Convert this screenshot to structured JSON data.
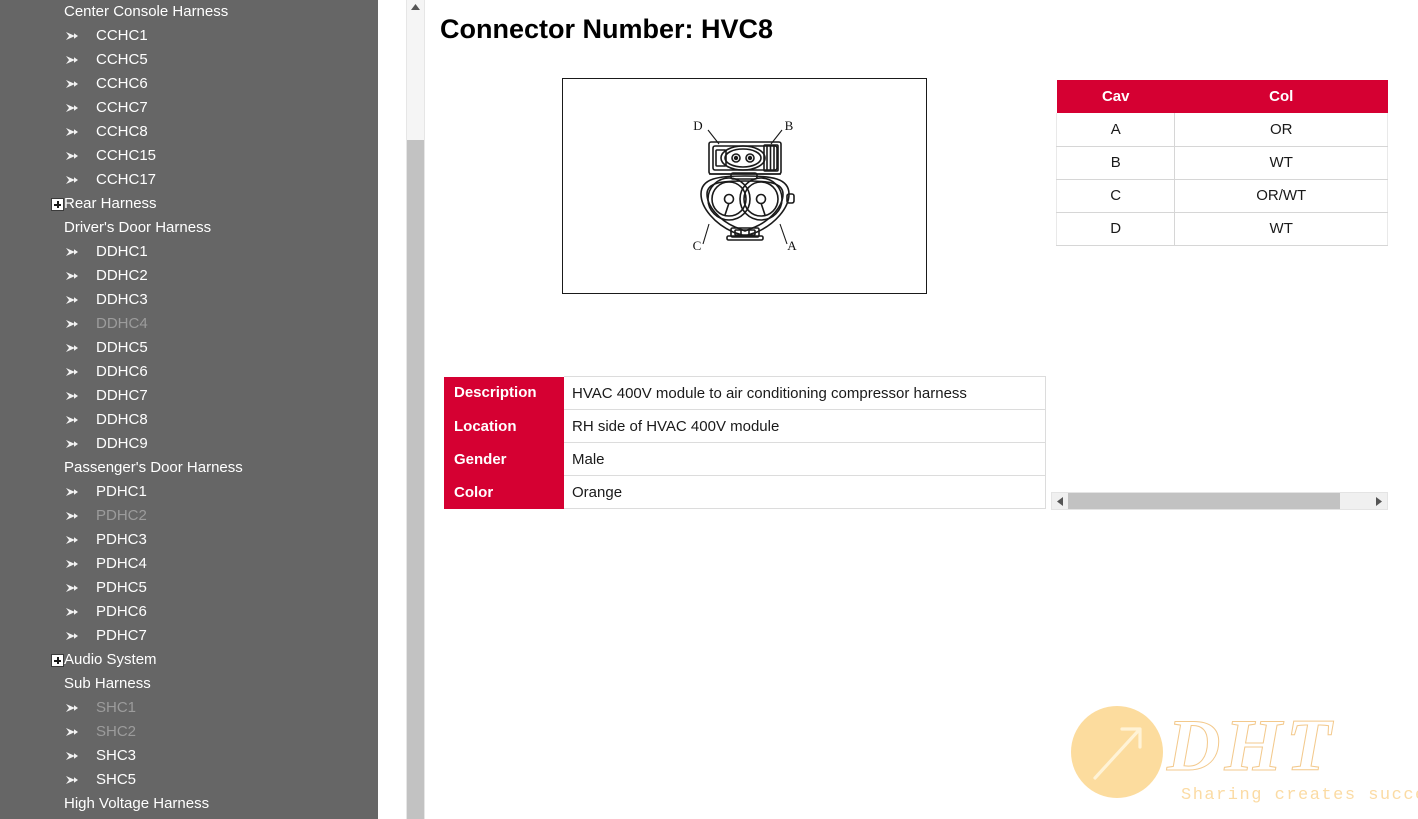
{
  "sidebar": {
    "background_color": "#666666",
    "items": [
      {
        "label": "Center Console Harness",
        "type": "group",
        "icon": "none",
        "dim": false
      },
      {
        "label": "CCHC1",
        "type": "child",
        "icon": "arrow-right-icon",
        "dim": false
      },
      {
        "label": "CCHC5",
        "type": "child",
        "icon": "arrow-right-icon",
        "dim": false
      },
      {
        "label": "CCHC6",
        "type": "child",
        "icon": "arrow-right-icon",
        "dim": false
      },
      {
        "label": "CCHC7",
        "type": "child",
        "icon": "arrow-right-icon",
        "dim": false
      },
      {
        "label": "CCHC8",
        "type": "child",
        "icon": "arrow-right-icon",
        "dim": false
      },
      {
        "label": "CCHC15",
        "type": "child",
        "icon": "arrow-right-icon",
        "dim": false
      },
      {
        "label": "CCHC17",
        "type": "child",
        "icon": "arrow-right-icon",
        "dim": false
      },
      {
        "label": "Rear Harness",
        "type": "group",
        "icon": "plus-box-icon",
        "dim": false
      },
      {
        "label": "Driver's Door Harness",
        "type": "group",
        "icon": "none",
        "dim": false
      },
      {
        "label": "DDHC1",
        "type": "child",
        "icon": "arrow-right-icon",
        "dim": false
      },
      {
        "label": "DDHC2",
        "type": "child",
        "icon": "arrow-right-icon",
        "dim": false
      },
      {
        "label": "DDHC3",
        "type": "child",
        "icon": "arrow-right-icon",
        "dim": false
      },
      {
        "label": "DDHC4",
        "type": "child",
        "icon": "arrow-right-icon",
        "dim": true
      },
      {
        "label": "DDHC5",
        "type": "child",
        "icon": "arrow-right-icon",
        "dim": false
      },
      {
        "label": "DDHC6",
        "type": "child",
        "icon": "arrow-right-icon",
        "dim": false
      },
      {
        "label": "DDHC7",
        "type": "child",
        "icon": "arrow-right-icon",
        "dim": false
      },
      {
        "label": "DDHC8",
        "type": "child",
        "icon": "arrow-right-icon",
        "dim": false
      },
      {
        "label": "DDHC9",
        "type": "child",
        "icon": "arrow-right-icon",
        "dim": false
      },
      {
        "label": "Passenger's Door Harness",
        "type": "group",
        "icon": "none",
        "dim": false
      },
      {
        "label": "PDHC1",
        "type": "child",
        "icon": "arrow-right-icon",
        "dim": false
      },
      {
        "label": "PDHC2",
        "type": "child",
        "icon": "arrow-right-icon",
        "dim": true
      },
      {
        "label": "PDHC3",
        "type": "child",
        "icon": "arrow-right-icon",
        "dim": false
      },
      {
        "label": "PDHC4",
        "type": "child",
        "icon": "arrow-right-icon",
        "dim": false
      },
      {
        "label": "PDHC5",
        "type": "child",
        "icon": "arrow-right-icon",
        "dim": false
      },
      {
        "label": "PDHC6",
        "type": "child",
        "icon": "arrow-right-icon",
        "dim": false
      },
      {
        "label": "PDHC7",
        "type": "child",
        "icon": "arrow-right-icon",
        "dim": false
      },
      {
        "label": "Audio System",
        "type": "group",
        "icon": "plus-box-icon",
        "dim": false
      },
      {
        "label": "Sub Harness",
        "type": "group",
        "icon": "none",
        "dim": false
      },
      {
        "label": "SHC1",
        "type": "child",
        "icon": "arrow-right-icon",
        "dim": true
      },
      {
        "label": "SHC2",
        "type": "child",
        "icon": "arrow-right-icon",
        "dim": true
      },
      {
        "label": "SHC3",
        "type": "child",
        "icon": "arrow-right-icon",
        "dim": false
      },
      {
        "label": "SHC5",
        "type": "child",
        "icon": "arrow-right-icon",
        "dim": false
      },
      {
        "label": "High Voltage Harness",
        "type": "group",
        "icon": "none",
        "dim": false
      }
    ]
  },
  "main": {
    "title": "Connector Number: HVC8",
    "accent_color": "#D50032",
    "connector_image": {
      "alt": "HVC8 connector face view",
      "cavity_labels": [
        "D",
        "B",
        "C",
        "A"
      ]
    },
    "cav_table": {
      "headers": [
        "Cav",
        "Col"
      ],
      "rows": [
        {
          "cav": "A",
          "col": "OR"
        },
        {
          "cav": "B",
          "col": "WT"
        },
        {
          "cav": "C",
          "col": "OR/WT"
        },
        {
          "cav": "D",
          "col": "WT"
        }
      ]
    },
    "details_table": {
      "rows": [
        {
          "label": "Description",
          "value": "HVAC 400V module to air conditioning compressor harness"
        },
        {
          "label": "Location",
          "value": "RH side of HVAC 400V module"
        },
        {
          "label": "Gender",
          "value": "Male"
        },
        {
          "label": "Color",
          "value": "Orange"
        }
      ]
    }
  },
  "watermark": {
    "logo_text": "DHT",
    "tagline": "Sharing creates success",
    "color": "#fbdba4"
  }
}
